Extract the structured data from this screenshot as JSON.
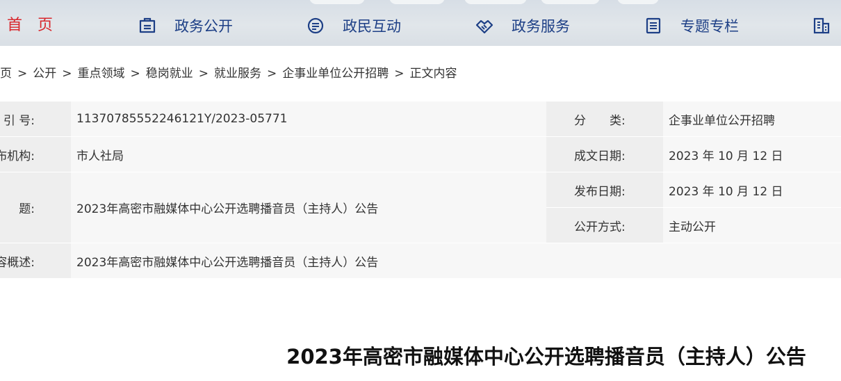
{
  "nav": {
    "home_label": "首　页",
    "items": [
      {
        "label": "政务公开",
        "icon": "document-icon"
      },
      {
        "label": "政民互动",
        "icon": "chat-icon"
      },
      {
        "label": "政务服务",
        "icon": "handshake-icon"
      },
      {
        "label": "专题专栏",
        "icon": "notebook-icon"
      },
      {
        "label": "",
        "icon": "building-icon"
      }
    ]
  },
  "breadcrumb": [
    "页",
    "公开",
    "重点领域",
    "稳岗就业",
    "就业服务",
    "企事业单位公开招聘",
    "正文内容"
  ],
  "breadcrumb_separator": ">",
  "info": {
    "index_label": "引 号:",
    "index_value": "11370785552246121Y/2023-05771",
    "category_label": "分　　类:",
    "category_value": "企事业单位公开招聘",
    "org_label": "布机构:",
    "org_value": "市人社局",
    "created_label": "成文日期:",
    "created_value": "2023 年 10 月 12 日",
    "title_label": "题:",
    "title_value": "2023年高密市融媒体中心公开选聘播音员（主持人）公告",
    "published_label": "发布日期:",
    "published_value": "2023 年 10 月 12 日",
    "mode_label": "公开方式:",
    "mode_value": "主动公开",
    "summary_label": "容概述:",
    "summary_value": "2023年高密市融媒体中心公开选聘播音员（主持人）公告"
  },
  "article": {
    "title": "2023年高密市融媒体中心公开选聘播音员（主持人）公告"
  },
  "colors": {
    "nav_text": "#1d3f86",
    "home_text": "#d8272d",
    "label_bg": "#eeeeee",
    "value_bg": "#f7f7f7"
  }
}
